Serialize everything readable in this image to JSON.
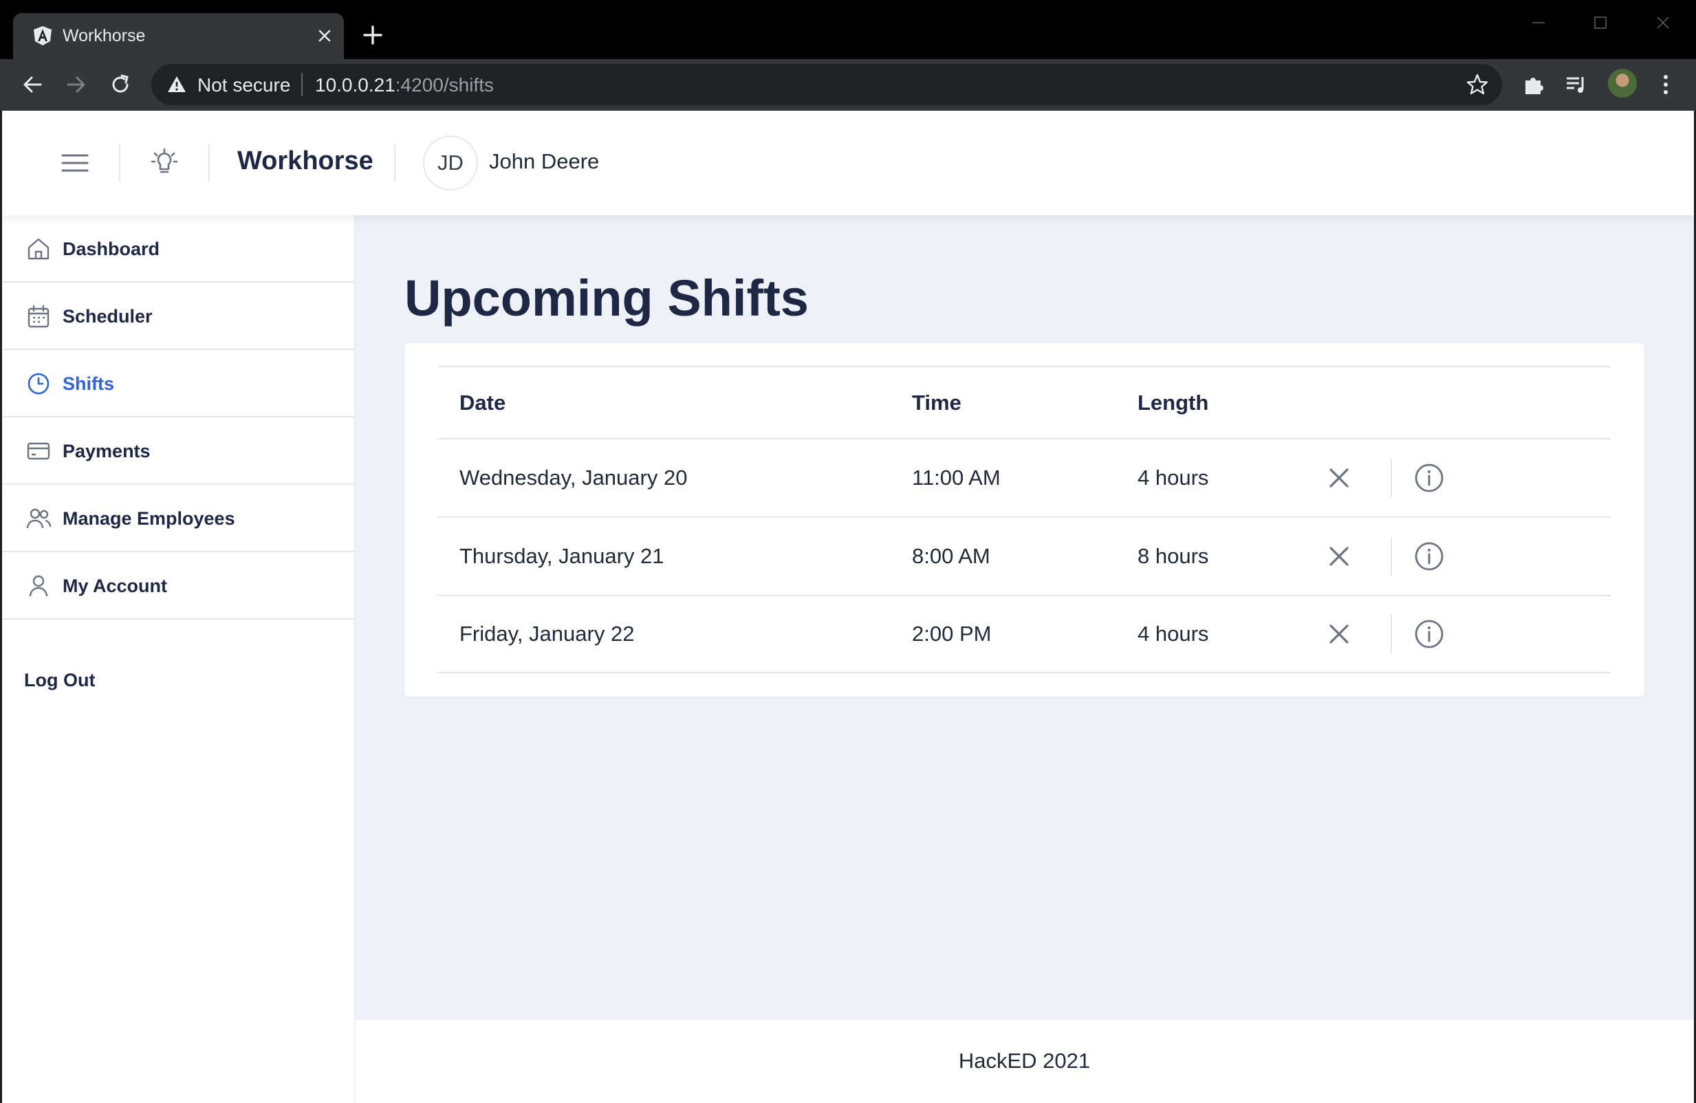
{
  "browser": {
    "tab_title": "Workhorse",
    "security_label": "Not secure",
    "url_host": "10.0.0.21",
    "url_path": ":4200/shifts"
  },
  "header": {
    "brand": "Workhorse",
    "user_initials": "JD",
    "user_name": "John Deere"
  },
  "sidebar": {
    "items": [
      {
        "label": "Dashboard",
        "icon": "home-icon"
      },
      {
        "label": "Scheduler",
        "icon": "calendar-icon"
      },
      {
        "label": "Shifts",
        "icon": "clock-icon",
        "active": true
      },
      {
        "label": "Payments",
        "icon": "credit-card-icon"
      },
      {
        "label": "Manage Employees",
        "icon": "users-icon"
      },
      {
        "label": "My Account",
        "icon": "user-icon"
      }
    ],
    "logout": "Log Out"
  },
  "main": {
    "title": "Upcoming Shifts",
    "columns": [
      "Date",
      "Time",
      "Length"
    ],
    "rows": [
      {
        "date": "Wednesday, January 20",
        "time": "11:00 AM",
        "length": "4 hours"
      },
      {
        "date": "Thursday, January 21",
        "time": "8:00 AM",
        "length": "8 hours"
      },
      {
        "date": "Friday, January 22",
        "time": "2:00 PM",
        "length": "4 hours"
      }
    ]
  },
  "footer": {
    "text": "HackED 2021"
  },
  "colors": {
    "accent": "#2f64d6",
    "heading": "#1e2844",
    "main_bg": "#eef1f7"
  }
}
